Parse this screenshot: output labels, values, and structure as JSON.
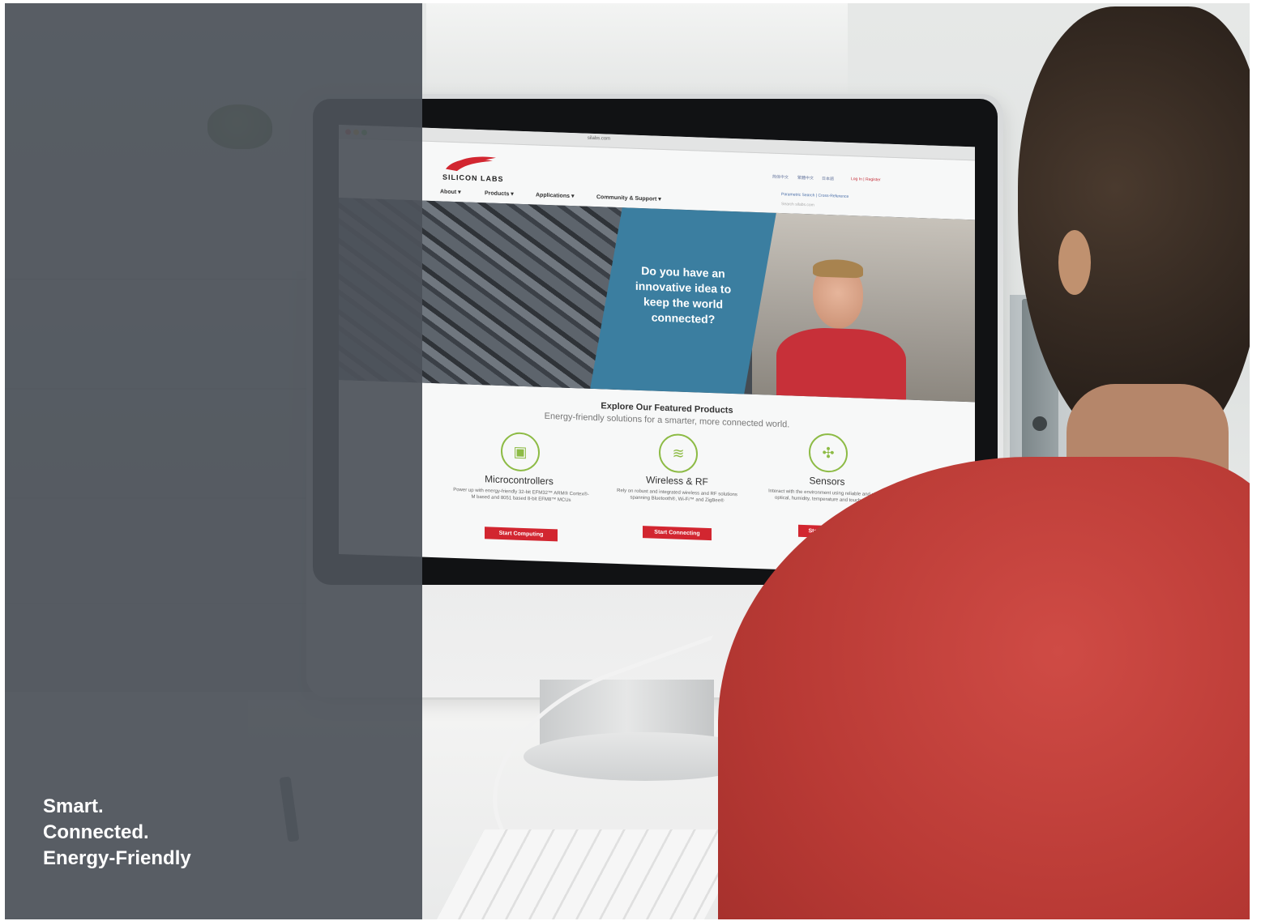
{
  "website": {
    "logo_text": "SILICON LABS",
    "url": "silabs.com",
    "nav": [
      "About ▾",
      "Products ▾",
      "Applications ▾",
      "Community & Support ▾"
    ],
    "languages": [
      "简体中文",
      "繁體中文",
      "日本語"
    ],
    "login": "Log In | Register",
    "parametric_search": "Parametric Search | Cross-Reference",
    "search_placeholder": "Search silabs.com",
    "hero_headline": "Do you have an innovative idea to keep the world connected?",
    "featured_title": "Explore Our Featured Products",
    "featured_subtitle": "Energy-friendly solutions for a smarter, more connected world.",
    "products": [
      {
        "title": "Microcontrollers",
        "description": "Power up with energy-friendly 32-bit EFM32™ ARM® Cortex®-M based and 8051 based 8-bit EFM8™ MCUs",
        "button": "Start Computing",
        "icon": "chip-icon"
      },
      {
        "title": "Wireless & RF",
        "description": "Rely on robust and integrated wireless and RF solutions spanning Bluetooth®, Wi-Fi™ and ZigBee®",
        "button": "Start Connecting",
        "icon": "wifi-icon"
      },
      {
        "title": "Sensors",
        "description": "Interact with the environment using reliable and simple optical, humidity, temperature and touch sensors",
        "button": "Start Sensing",
        "icon": "sensor-icon"
      }
    ]
  },
  "tagline": [
    "Smart.",
    "Connected.",
    "Energy-Friendly"
  ],
  "colors": {
    "overlay": "#4c5259",
    "brand_red": "#d22630",
    "hero_blue": "#3b7ea0",
    "icon_green": "#8dbb45",
    "shirt_red": "#c0413b"
  }
}
